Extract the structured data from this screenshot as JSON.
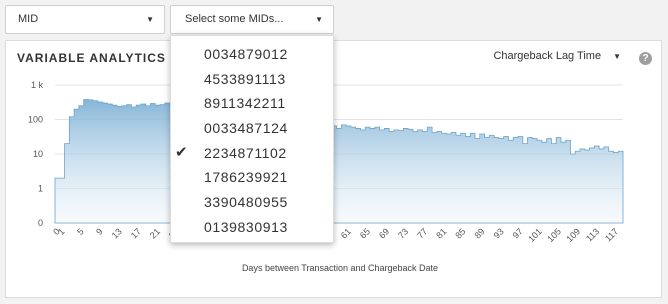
{
  "filters": {
    "mid_select": {
      "label": "MID"
    },
    "mids_select": {
      "placeholder": "Select some MIDs..."
    }
  },
  "panel": {
    "title": "VARIABLE ANALYTICS - C",
    "metric": "Chargeback Lag Time",
    "help": "?"
  },
  "dropdown": {
    "options": [
      {
        "label": "0034879012",
        "checked": false
      },
      {
        "label": "4533891113",
        "checked": false
      },
      {
        "label": "8911342211",
        "checked": false
      },
      {
        "label": "0033487124",
        "checked": false
      },
      {
        "label": "2234871102",
        "checked": true
      },
      {
        "label": "1786239921",
        "checked": false
      },
      {
        "label": "3390480955",
        "checked": false
      },
      {
        "label": "0139830913",
        "checked": false
      }
    ],
    "check_icon": "check-icon"
  },
  "chart_data": {
    "type": "area",
    "xlabel": "Days between Transaction and Chargeback Date",
    "ylabel": "",
    "yscale": "log",
    "yticks": [
      "0",
      "1",
      "10",
      "100",
      "1 k"
    ],
    "xticks": [
      "0",
      "1",
      "5",
      "9",
      "13",
      "17",
      "21",
      "25",
      "29",
      "33",
      "37",
      "41",
      "45",
      "49",
      "53",
      "57",
      "61",
      "65",
      "69",
      "73",
      "77",
      "81",
      "85",
      "89",
      "93",
      "97",
      "101",
      "105",
      "109",
      "113",
      "117"
    ],
    "x": [
      0,
      1,
      2,
      3,
      4,
      5,
      6,
      7,
      8,
      9,
      10,
      11,
      12,
      13,
      14,
      15,
      16,
      17,
      18,
      19,
      20,
      21,
      22,
      23,
      24,
      25,
      26,
      27,
      28,
      29,
      30,
      31,
      32,
      33,
      34,
      35,
      36,
      37,
      38,
      39,
      40,
      41,
      42,
      43,
      44,
      45,
      46,
      47,
      48,
      49,
      50,
      51,
      52,
      53,
      54,
      55,
      56,
      57,
      58,
      59,
      60,
      61,
      62,
      63,
      64,
      65,
      66,
      67,
      68,
      69,
      70,
      71,
      72,
      73,
      74,
      75,
      76,
      77,
      78,
      79,
      80,
      81,
      82,
      83,
      84,
      85,
      86,
      87,
      88,
      89,
      90,
      91,
      92,
      93,
      94,
      95,
      96,
      97,
      98,
      99,
      100,
      101,
      102,
      103,
      104,
      105,
      106,
      107,
      108,
      109,
      110,
      111,
      112,
      113,
      114,
      115,
      116,
      117,
      118
    ],
    "values": [
      2,
      2,
      20,
      120,
      200,
      250,
      380,
      370,
      350,
      320,
      300,
      280,
      260,
      240,
      250,
      270,
      230,
      260,
      280,
      250,
      290,
      260,
      270,
      300,
      250,
      240,
      230,
      220,
      230,
      210,
      220,
      200,
      190,
      180,
      200,
      180,
      170,
      160,
      170,
      150,
      160,
      140,
      130,
      120,
      110,
      100,
      100,
      95,
      90,
      85,
      90,
      80,
      85,
      70,
      75,
      65,
      60,
      70,
      65,
      55,
      70,
      65,
      60,
      55,
      50,
      60,
      55,
      60,
      50,
      55,
      45,
      50,
      48,
      55,
      52,
      45,
      50,
      45,
      60,
      42,
      45,
      40,
      38,
      42,
      35,
      40,
      32,
      40,
      28,
      38,
      30,
      35,
      30,
      28,
      32,
      25,
      30,
      32,
      20,
      30,
      28,
      25,
      22,
      28,
      20,
      30,
      22,
      25,
      10,
      12,
      14,
      13,
      15,
      17,
      14,
      16,
      12,
      11,
      12
    ]
  }
}
